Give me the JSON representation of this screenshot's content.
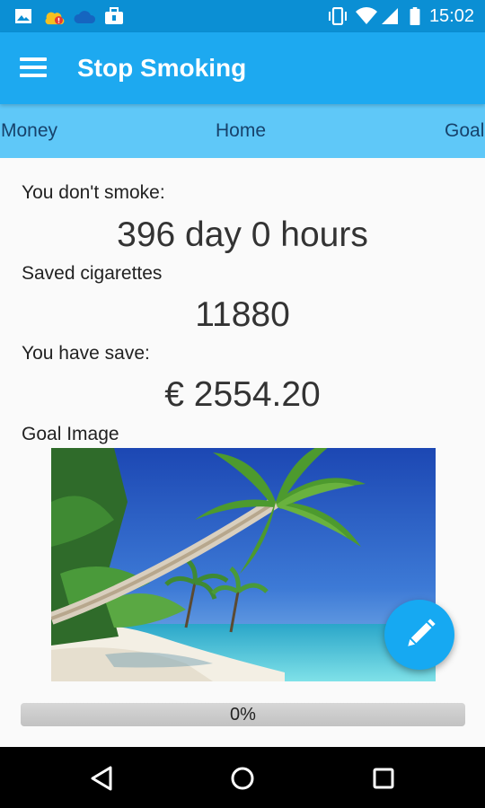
{
  "status_bar": {
    "time": "15:02",
    "left_icons": [
      "image-icon",
      "weather-alert-icon",
      "cloud-icon",
      "briefcase-icon"
    ],
    "right_icons": [
      "vibrate-icon",
      "wifi-icon",
      "signal-icon",
      "battery-icon"
    ]
  },
  "app_bar": {
    "title": "Stop Smoking",
    "background": "#1da9f0"
  },
  "tabs": [
    {
      "label": "Money"
    },
    {
      "label": "Home"
    },
    {
      "label": "Goal"
    }
  ],
  "stats": {
    "no_smoke_label": "You don't smoke:",
    "no_smoke_value": "396 day 0 hours",
    "saved_cigs_label": "Saved cigarettes",
    "saved_cigs_value": "11880",
    "saved_money_label": "You have save:",
    "saved_money_value": "€ 2554.20"
  },
  "goal": {
    "image_label": "Goal Image",
    "progress_text": "0%",
    "progress_fraction": 0
  },
  "fab": {
    "icon": "pencil-icon",
    "color": "#16a9f2"
  },
  "nav": {
    "icons": [
      "back-icon",
      "home-icon",
      "recents-icon"
    ]
  }
}
